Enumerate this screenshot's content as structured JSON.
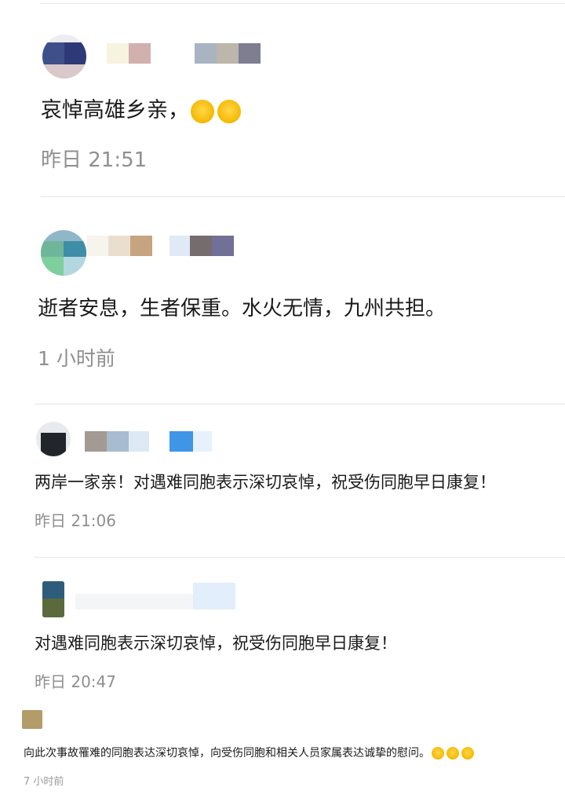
{
  "comments": [
    {
      "text": "哀悼高雄乡亲，",
      "emoji_count": 2,
      "emoji_icon": "crying-face-icon",
      "time": "昨日 21:51"
    },
    {
      "text": "逝者安息，生者保重。水火无情，九州共担。",
      "time": "1 小时前"
    },
    {
      "text": "两岸一家亲！对遇难同胞表示深切哀悼，祝受伤同胞早日康复！",
      "time": "昨日 21:06"
    },
    {
      "text": "对遇难同胞表示深切哀悼，祝受伤同胞早日康复！",
      "time": "昨日 20:47"
    },
    {
      "text": "向此次事故罹难的同胞表达深切哀悼，向受伤同胞和相关人员家属表达诚挚的慰问。",
      "emoji_count": 3,
      "emoji_icon": "crying-face-icon",
      "time": "7 小时前"
    }
  ],
  "colors": {
    "text": "#1a1a1a",
    "time": "#8f8f8f",
    "divider": "#e6e6e6",
    "emoji_face": "#f5b800",
    "emoji_tears": "#3aa0ff"
  }
}
